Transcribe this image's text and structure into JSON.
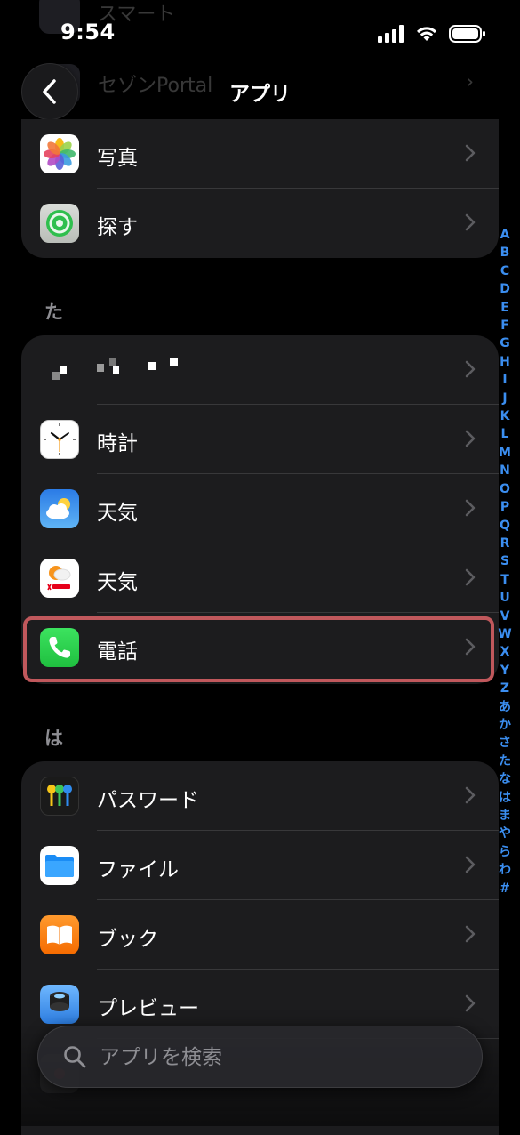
{
  "status": {
    "time": "9:54"
  },
  "nav": {
    "title": "アプリ",
    "back_label": "back"
  },
  "ghost": {
    "row1": "スマート",
    "row2": "セゾンPortal"
  },
  "group_top": [
    {
      "label": "写真",
      "icon": "photos-icon"
    },
    {
      "label": "探す",
      "icon": "find-my-icon"
    }
  ],
  "section_ta": {
    "header": "た"
  },
  "group_ta": [
    {
      "label": "",
      "icon": "redacted-app-icon"
    },
    {
      "label": "時計",
      "icon": "clock-icon"
    },
    {
      "label": "天気",
      "icon": "weather-icon"
    },
    {
      "label": "天気",
      "icon": "yahoo-weather-icon"
    },
    {
      "label": "電話",
      "icon": "phone-icon"
    }
  ],
  "section_ha": {
    "header": "は"
  },
  "group_ha": [
    {
      "label": "パスワード",
      "icon": "passwords-icon"
    },
    {
      "label": "ファイル",
      "icon": "files-icon"
    },
    {
      "label": "ブック",
      "icon": "books-icon"
    },
    {
      "label": "プレビュー",
      "icon": "preview-icon"
    }
  ],
  "index": [
    "A",
    "B",
    "C",
    "D",
    "E",
    "F",
    "G",
    "H",
    "I",
    "J",
    "K",
    "L",
    "M",
    "N",
    "O",
    "P",
    "Q",
    "R",
    "S",
    "T",
    "U",
    "V",
    "W",
    "X",
    "Y",
    "Z",
    "あ",
    "か",
    "さ",
    "た",
    "な",
    "は",
    "ま",
    "や",
    "ら",
    "わ",
    "#"
  ],
  "search": {
    "placeholder": "アプリを検索"
  },
  "colors": {
    "accent": "#3b8ef0",
    "highlight": "#c0585c",
    "cell": "#1c1c1e"
  }
}
